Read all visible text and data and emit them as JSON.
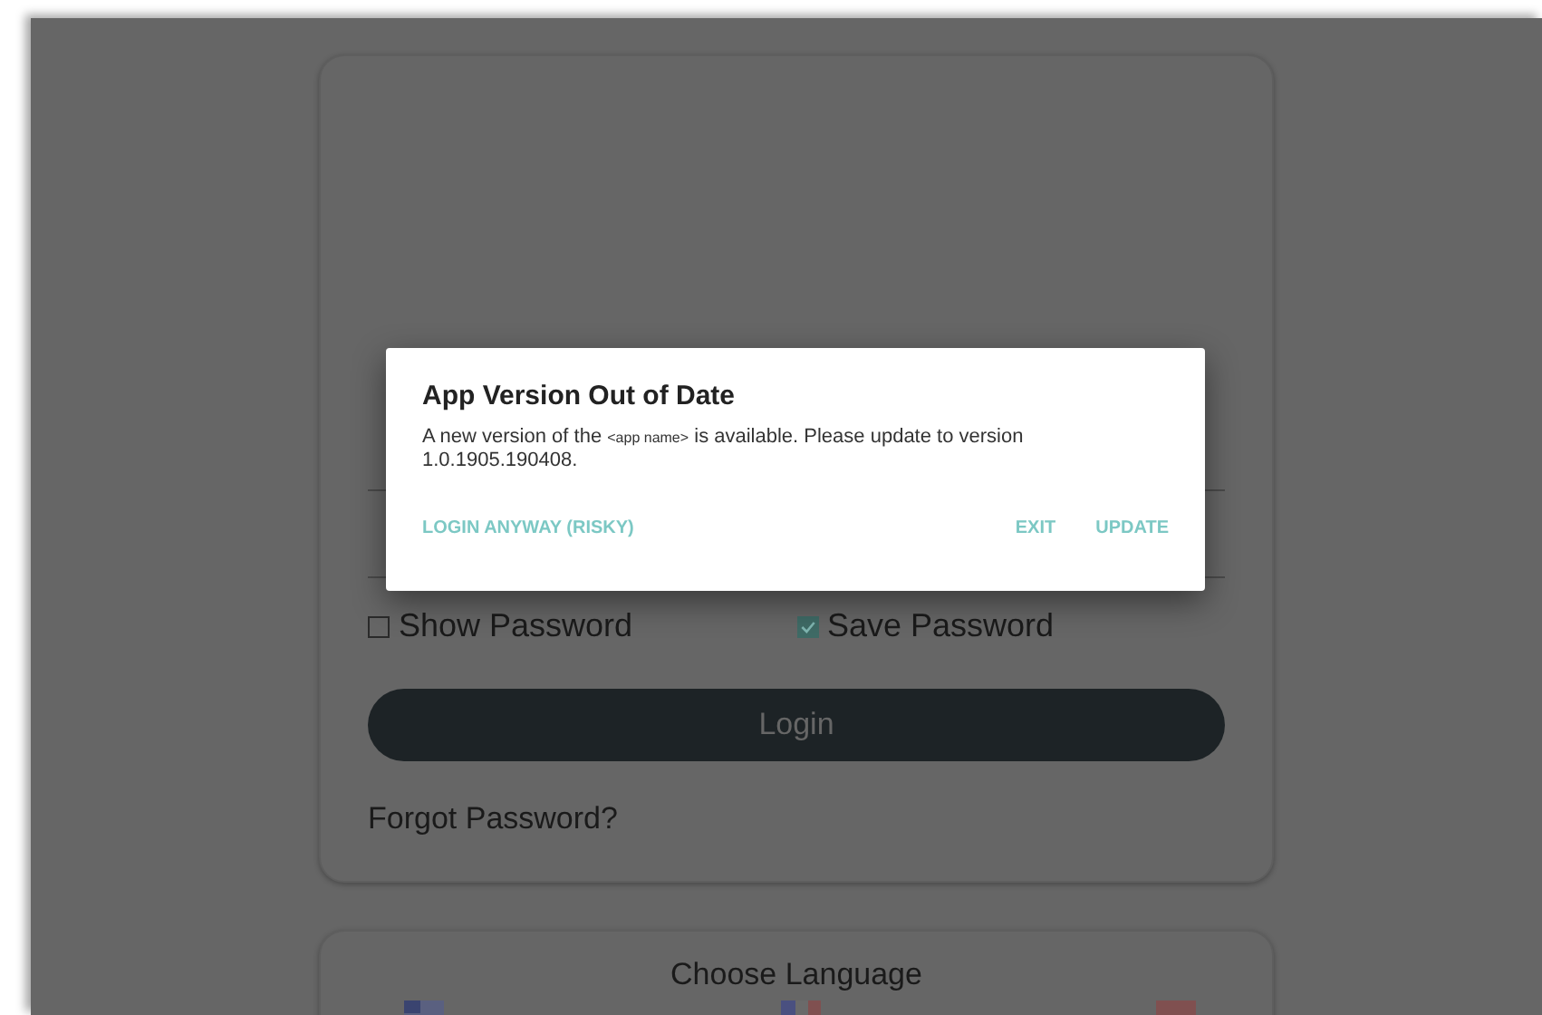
{
  "login": {
    "show_password": {
      "label": "Show Password",
      "checked": false
    },
    "save_password": {
      "label": "Save Password",
      "checked": true
    },
    "login_button": "Login",
    "forgot_link": "Forgot Password?"
  },
  "language": {
    "title": "Choose Language"
  },
  "dialog": {
    "title": "App Version Out of Date",
    "message": {
      "before": "A new version of the",
      "app_name": "<app name>",
      "after": "is available. Please update to version 1.0.1905.190408."
    },
    "left_buttons": [
      "LOGIN ANYWAY (RISKY)"
    ],
    "right_buttons": [
      "EXIT",
      "UPDATE"
    ]
  }
}
